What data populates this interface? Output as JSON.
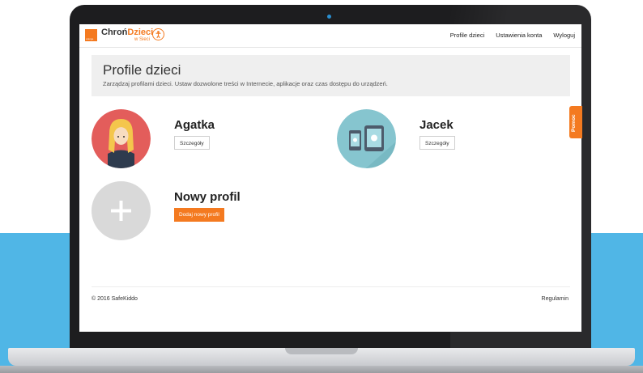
{
  "brand": {
    "logo_text": "orange",
    "name_part1": "Chroń",
    "name_part2": "Dzieci",
    "name_sub": "w Sieci"
  },
  "nav": {
    "items": [
      "Profile dzieci",
      "Ustawienia konta",
      "Wyloguj"
    ]
  },
  "header": {
    "title": "Profile dzieci",
    "subtitle": "Zarządzaj profilami dzieci. Ustaw dozwolone treści w Internecie, aplikacje oraz czas dostępu do urządzeń."
  },
  "profiles": [
    {
      "name": "Agatka",
      "button": "Szczegóły",
      "avatar_icon": "girl-avatar-icon",
      "avatar_color": "#e35d5b"
    },
    {
      "name": "Jacek",
      "button": "Szczegóły",
      "avatar_icon": "devices-avatar-icon",
      "avatar_color": "#86c5cf"
    }
  ],
  "new_profile": {
    "title": "Nowy profil",
    "button": "Dodaj nowy profil",
    "icon": "plus-icon"
  },
  "footer": {
    "copyright": "© 2016 SafeKiddo",
    "link": "Regulamin"
  },
  "help_tab": {
    "label": "Pomoc"
  },
  "colors": {
    "accent": "#f47a20",
    "background_blue": "#50b6e6",
    "header_bg": "#efefef"
  }
}
